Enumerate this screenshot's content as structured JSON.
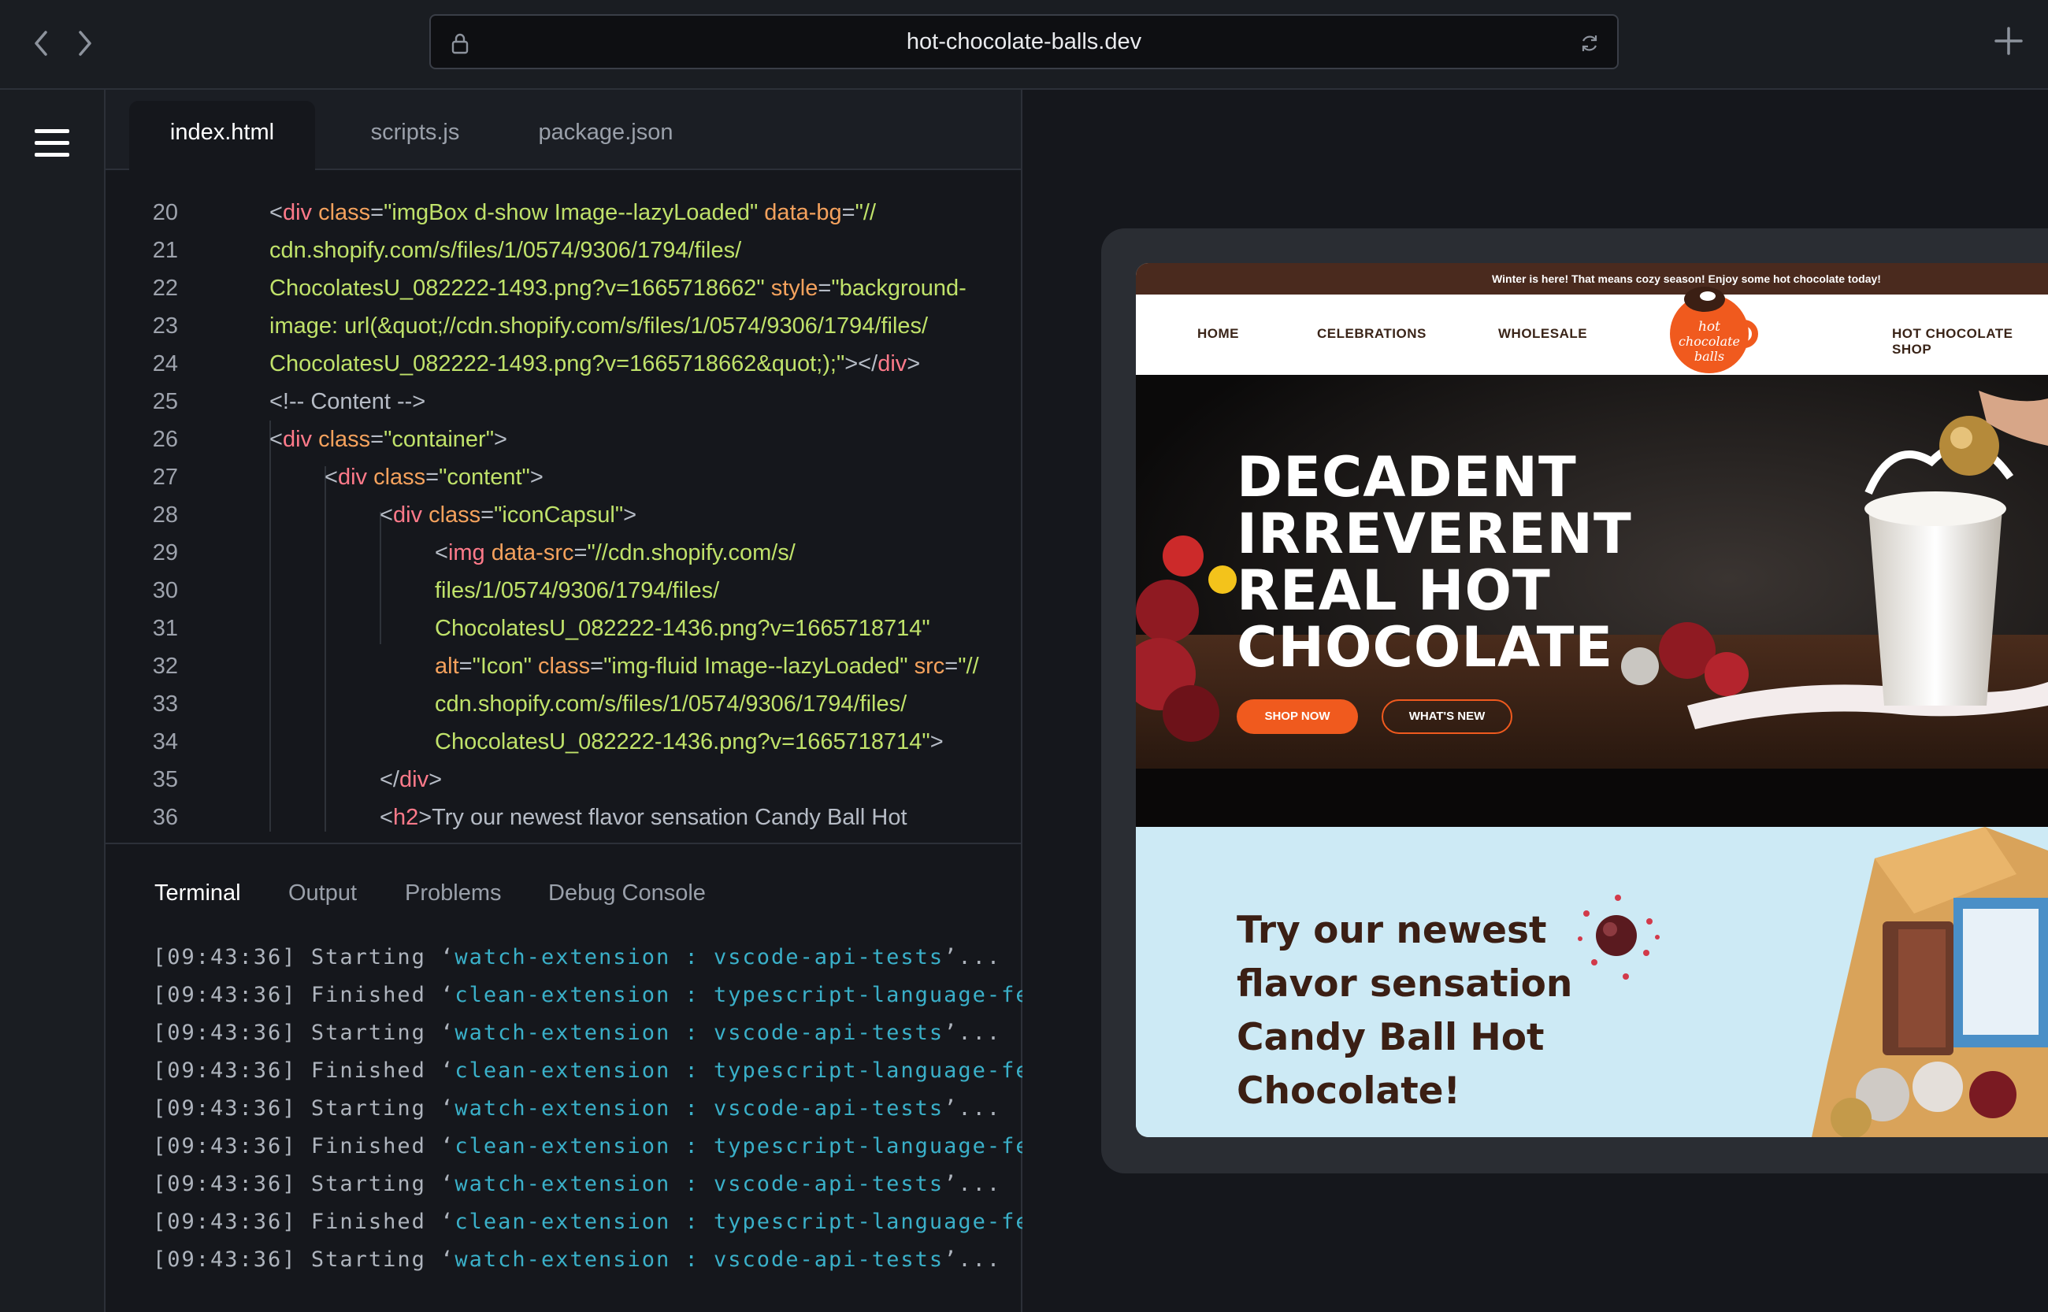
{
  "browser": {
    "url": "hot-chocolate-balls.dev"
  },
  "editor": {
    "tabs": [
      {
        "label": "index.html",
        "active": true
      },
      {
        "label": "scripts.js",
        "active": false
      },
      {
        "label": "package.json",
        "active": false
      }
    ],
    "line_numbers": [
      "20",
      "21",
      "22",
      "23",
      "24",
      "25",
      "26",
      "27",
      "28",
      "29",
      "30",
      "31",
      "32",
      "33",
      "34",
      "35",
      "36"
    ],
    "code": {
      "l20": {
        "open": "<",
        "tag": "div",
        "attr1": " class",
        "eq1": "=",
        "str1": "\"imgBox d-show Image--lazyLoaded\"",
        "attr2": " data-bg",
        "eq2": "=",
        "str2": "\"//"
      },
      "l21": {
        "str": "cdn.shopify.com/s/files/1/0574/9306/1794/files/"
      },
      "l22": {
        "str": "ChocolatesU_082222-1493.png?v=1665718662\"",
        "attr": " style",
        "eq": "=",
        "str2": "\"background-"
      },
      "l23": {
        "str": "image: url(&quot;//cdn.shopify.com/s/files/1/0574/9306/1794/files/"
      },
      "l24": {
        "str": "ChocolatesU_082222-1493.png?v=1665718662&quot;);\"",
        "close1": "></",
        "tag": "div",
        "close2": ">"
      },
      "l25": {
        "text": "<!-- Content  -->"
      },
      "l26": {
        "open": "<",
        "tag": "div",
        "attr": " class",
        "eq": "=",
        "str": "\"container\"",
        "close": ">"
      },
      "l27": {
        "open": "<",
        "tag": "div",
        "attr": " class",
        "eq": "=",
        "str": "\"content\"",
        "close": ">"
      },
      "l28": {
        "open": "<",
        "tag": "div",
        "attr": " class",
        "eq": "=",
        "str": "\"iconCapsul\"",
        "close": ">"
      },
      "l29": {
        "open": "<",
        "tag": "img",
        "attr": " data-src",
        "eq": "=",
        "str": "\"//cdn.shopify.com/s/"
      },
      "l30": {
        "str": "files/1/0574/9306/1794/files/"
      },
      "l31": {
        "str": "ChocolatesU_082222-1436.png?v=1665718714\""
      },
      "l32": {
        "attr1": "alt",
        "eq1": "=",
        "str1": "\"Icon\"",
        "attr2": " class",
        "eq2": "=",
        "str2": "\"img-fluid Image--lazyLoaded\"",
        "attr3": " src",
        "eq3": "=",
        "str3": "\"//"
      },
      "l33": {
        "str": "cdn.shopify.com/s/files/1/0574/9306/1794/files/"
      },
      "l34": {
        "str": "ChocolatesU_082222-1436.png?v=1665718714\"",
        "close": ">"
      },
      "l35": {
        "open": "</",
        "tag": "div",
        "close": ">"
      },
      "l36": {
        "open": "<",
        "tag": "h2",
        "close": ">",
        "text": "Try our newest flavor sensation Candy Ball Hot"
      }
    }
  },
  "panel": {
    "tabs": [
      {
        "label": "Terminal",
        "active": true
      },
      {
        "label": "Output",
        "active": false
      },
      {
        "label": "Problems",
        "active": false
      },
      {
        "label": "Debug Console",
        "active": false
      }
    ],
    "log": [
      {
        "time": "[09:43:36]",
        "status": "Starting",
        "quote": "‘",
        "task": "watch-extension : vscode-api-tests",
        "tail": "’..."
      },
      {
        "time": "[09:43:36]",
        "status": "Finished",
        "quote": "‘",
        "task": "clean-extension : typescript-language-feat",
        "tail": ""
      },
      {
        "time": "[09:43:36]",
        "status": "Starting",
        "quote": "‘",
        "task": "watch-extension : vscode-api-tests",
        "tail": "’..."
      },
      {
        "time": "[09:43:36]",
        "status": "Finished",
        "quote": "‘",
        "task": "clean-extension : typescript-language-feat",
        "tail": ""
      },
      {
        "time": "[09:43:36]",
        "status": "Starting",
        "quote": "‘",
        "task": "watch-extension : vscode-api-tests",
        "tail": "’..."
      },
      {
        "time": "[09:43:36]",
        "status": "Finished",
        "quote": "‘",
        "task": "clean-extension : typescript-language-feat",
        "tail": ""
      },
      {
        "time": "[09:43:36]",
        "status": "Starting",
        "quote": "‘",
        "task": "watch-extension : vscode-api-tests",
        "tail": "’..."
      },
      {
        "time": "[09:43:36]",
        "status": "Finished",
        "quote": "‘",
        "task": "clean-extension : typescript-language-feat",
        "tail": ""
      },
      {
        "time": "[09:43:36]",
        "status": "Starting",
        "quote": "‘",
        "task": "watch-extension : vscode-api-tests",
        "tail": "’..."
      }
    ]
  },
  "preview": {
    "announcement": "Winter is here! That means cozy season! Enjoy some hot chocolate today!",
    "nav": [
      "HOME",
      "CELEBRATIONS",
      "WHOLESALE",
      "HOT CHOCOLATE SHOP"
    ],
    "logo_text": [
      "hot",
      "chocolate",
      "balls"
    ],
    "hero_title": [
      "DECADENT",
      "IRREVERENT",
      "REAL HOT",
      "CHOCOLATE"
    ],
    "shop_now": "SHOP NOW",
    "whats_new": "WHAT'S NEW",
    "promo_title": [
      "Try our newest",
      "flavor sensation",
      "Candy Ball Hot",
      "Chocolate!"
    ]
  },
  "colors": {
    "tag": "#ff7a8a",
    "attr": "#f5a25d",
    "string": "#c0e26a",
    "terminal_accent": "#3ab0c9",
    "brand_orange": "#f05a1e",
    "brand_brown": "#3b1f14",
    "promo_bg": "#cdeaf5"
  },
  "icons": [
    "chevron-left-icon",
    "chevron-right-icon",
    "lock-icon",
    "reload-icon",
    "plus-icon",
    "menu-icon"
  ]
}
